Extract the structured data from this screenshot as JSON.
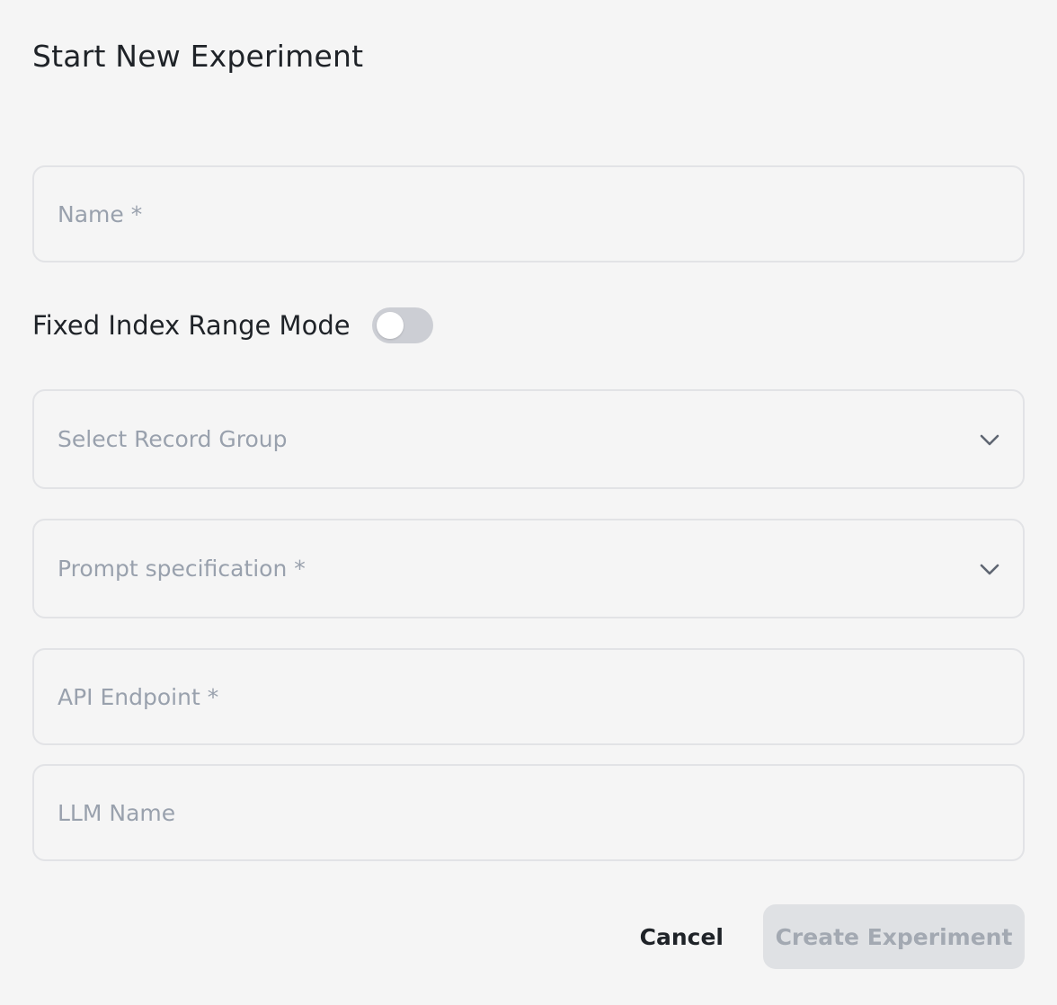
{
  "dialog": {
    "title": "Start New Experiment"
  },
  "form": {
    "name_placeholder": "Name *",
    "fixed_index_range_label": "Fixed Index Range Mode",
    "fixed_index_range_enabled": false,
    "record_group_placeholder": "Select Record Group",
    "prompt_spec_placeholder": "Prompt specification *",
    "api_endpoint_placeholder": "API Endpoint *",
    "llm_name_placeholder": "LLM Name"
  },
  "actions": {
    "cancel_label": "Cancel",
    "create_label": "Create Experiment",
    "create_disabled": true
  },
  "icons": {
    "select_chevron": "chevron-down-icon"
  },
  "colors": {
    "background": "#f5f5f5",
    "field_border": "#e2e3e6",
    "placeholder": "#99a1ad",
    "toggle_off": "#ccced4",
    "disabled_button_bg": "#dfe1e4",
    "disabled_button_text": "#a3a9b2",
    "text_primary": "#1f2328"
  }
}
